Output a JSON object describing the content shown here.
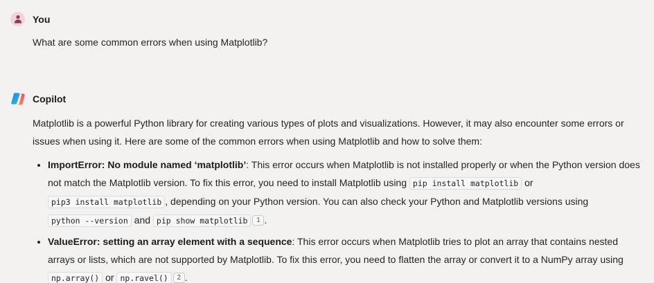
{
  "user_message": {
    "sender": "You",
    "text": "What are some common errors when using Matplotlib?"
  },
  "copilot_message": {
    "sender": "Copilot",
    "intro": "Matplotlib is a powerful Python library for creating various types of plots and visualizations. However, it may also encounter some errors or issues when using it. Here are some of the common errors when using Matplotlib and how to solve them:",
    "items": [
      {
        "title": "ImportError: No module named ‘matplotlib’",
        "t1": ": This error occurs when Matplotlib is not installed properly or when the Python version does not match the Matplotlib version. To fix this error, you need to install Matplotlib using ",
        "c1": "pip install matplotlib",
        "t2": " or ",
        "c2": "pip3 install matplotlib",
        "t3": ", depending on your Python version. You can also check your Python and Matplotlib versions using ",
        "c3": "python --version",
        "t4": " and ",
        "c4": "pip show matplotlib",
        "cite": "1",
        "t5": "."
      },
      {
        "title": "ValueError: setting an array element with a sequence",
        "t1": ": This error occurs when Matplotlib tries to plot an array that contains nested arrays or lists, which are not supported by Matplotlib. To fix this error, you need to flatten the array or convert it to a NumPy array using ",
        "c1": "np.array()",
        "t2": " or ",
        "c2": "np.ravel()",
        "cite": "2",
        "t3": "."
      }
    ]
  },
  "colors": {
    "background": "#f3f2f1",
    "user_avatar_bg": "#f3d3dc",
    "user_avatar_fg": "#8a3b54"
  }
}
